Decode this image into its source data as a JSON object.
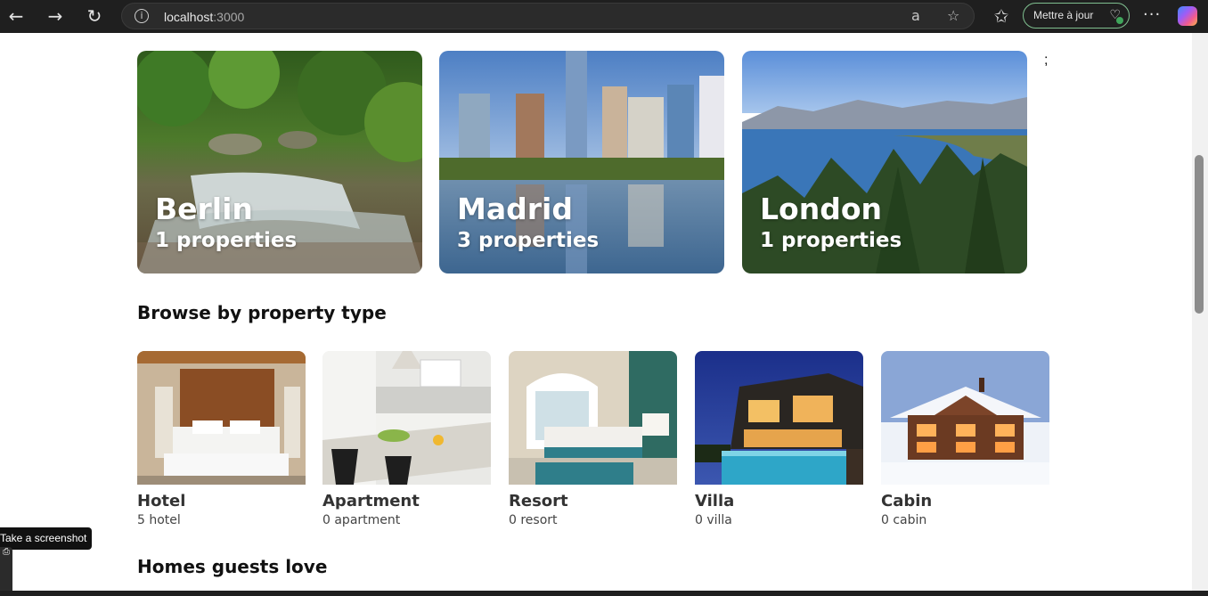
{
  "browser": {
    "url_host": "localhost",
    "url_port": ":3000",
    "update_button_label": "Mettre à jour",
    "more_label": "···"
  },
  "featured_cities": [
    {
      "name": "Berlin",
      "count": "1 properties"
    },
    {
      "name": "Madrid",
      "count": "3 properties"
    },
    {
      "name": "London",
      "count": "1 properties"
    }
  ],
  "stray_text": ";",
  "property_types_title": "Browse by property type",
  "property_types": [
    {
      "name": "Hotel",
      "count": "5 hotel"
    },
    {
      "name": "Apartment",
      "count": "0 apartment"
    },
    {
      "name": "Resort",
      "count": "0 resort"
    },
    {
      "name": "Villa",
      "count": "0 villa"
    },
    {
      "name": "Cabin",
      "count": "0 cabin"
    }
  ],
  "homes_title": "Homes guests love",
  "screenshot_tooltip": "Take a screenshot"
}
